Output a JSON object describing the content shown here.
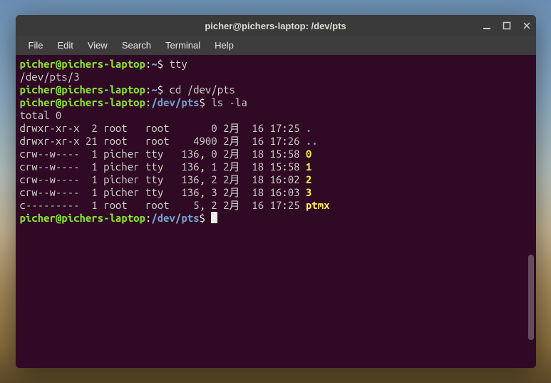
{
  "window": {
    "title": "picher@pichers-laptop: /dev/pts"
  },
  "menubar": {
    "items": [
      "File",
      "Edit",
      "View",
      "Search",
      "Terminal",
      "Help"
    ]
  },
  "prompt": {
    "user_host": "picher@pichers-laptop",
    "home_path": "~",
    "cwd_path": "/dev/pts",
    "symbol": "$"
  },
  "session": {
    "cmd1": "tty",
    "out1": "/dev/pts/3",
    "cmd2": "cd /dev/pts",
    "cmd3": "ls -la",
    "total": "total 0",
    "rows": [
      {
        "perms": "drwxr-xr-x",
        "links": " 2",
        "owner": "root  ",
        "group": "root  ",
        "size": "    0",
        "date": "2月  16 17:25",
        "name": ".",
        "cls": "blue"
      },
      {
        "perms": "drwxr-xr-x",
        "links": "21",
        "owner": "root  ",
        "group": "root  ",
        "size": " 4900",
        "date": "2月  16 17:26",
        "name": "..",
        "cls": "blue"
      },
      {
        "perms": "crw--w----",
        "links": " 1",
        "owner": "picher",
        "group": "tty  ",
        "size": "136, 0",
        "date": "2月  18 15:58",
        "name": "0",
        "cls": "yellow"
      },
      {
        "perms": "crw--w----",
        "links": " 1",
        "owner": "picher",
        "group": "tty  ",
        "size": "136, 1",
        "date": "2月  18 15:58",
        "name": "1",
        "cls": "yellow"
      },
      {
        "perms": "crw--w----",
        "links": " 1",
        "owner": "picher",
        "group": "tty  ",
        "size": "136, 2",
        "date": "2月  18 16:02",
        "name": "2",
        "cls": "yellow"
      },
      {
        "perms": "crw--w----",
        "links": " 1",
        "owner": "picher",
        "group": "tty  ",
        "size": "136, 3",
        "date": "2月  18 16:03",
        "name": "3",
        "cls": "yellow"
      },
      {
        "perms": "c---------",
        "links": " 1",
        "owner": "root  ",
        "group": "root  ",
        "size": " 5, 2",
        "date": "2月  16 17:25",
        "name": "ptmx",
        "cls": "yellow"
      }
    ]
  }
}
